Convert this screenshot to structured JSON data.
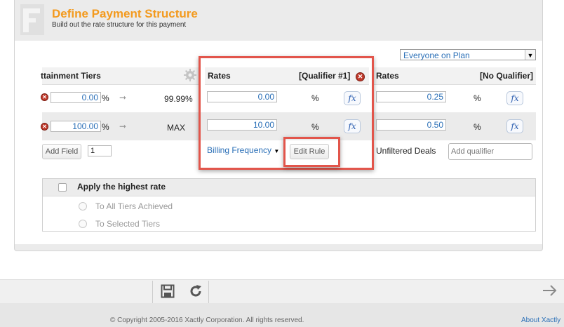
{
  "header": {
    "title": "Define Payment Structure",
    "subtitle": "Build out the rate structure for this payment"
  },
  "plan_select": {
    "value": "Everyone on Plan"
  },
  "tiers": {
    "header": "ttainment Tiers",
    "rows": [
      {
        "from": "0.00",
        "from_unit": "%",
        "to": "99.99%"
      },
      {
        "from": "100.00",
        "from_unit": "%",
        "to": "MAX"
      }
    ],
    "add_field_label": "Add Field",
    "add_field_count": "1"
  },
  "rates_q1": {
    "header_rates": "Rates",
    "header_qualifier": "[Qualifier #1]",
    "rows": [
      {
        "value": "0.00",
        "unit": "%",
        "fx": "fx"
      },
      {
        "value": "10.00",
        "unit": "%",
        "fx": "fx"
      }
    ],
    "billing_select": "Billing Frequency",
    "edit_rule_label": "Edit Rule"
  },
  "rates_noq": {
    "header_rates": "Rates",
    "header_qualifier": "[No Qualifier]",
    "rows": [
      {
        "value": "0.25",
        "unit": "%",
        "fx": "fx"
      },
      {
        "value": "0.50",
        "unit": "%",
        "fx": "fx"
      }
    ],
    "unfiltered_label": "Unfiltered Deals",
    "add_qualifier_placeholder": "Add qualifier"
  },
  "apply_highest": {
    "label": "Apply the highest rate",
    "options": [
      "To All Tiers Achieved",
      "To Selected Tiers"
    ]
  },
  "footer": {
    "copyright": "© Copyright 2005-2016 Xactly Corporation. All rights reserved.",
    "about": "About Xactly"
  },
  "icons": [
    "save-icon",
    "refresh-icon",
    "next-arrow-icon",
    "gear-icon",
    "delete-icon",
    "arrow-right-icon"
  ],
  "colors": {
    "accent": "#f39a1e",
    "link": "#2a6fb7",
    "highlight": "#e2554b"
  }
}
